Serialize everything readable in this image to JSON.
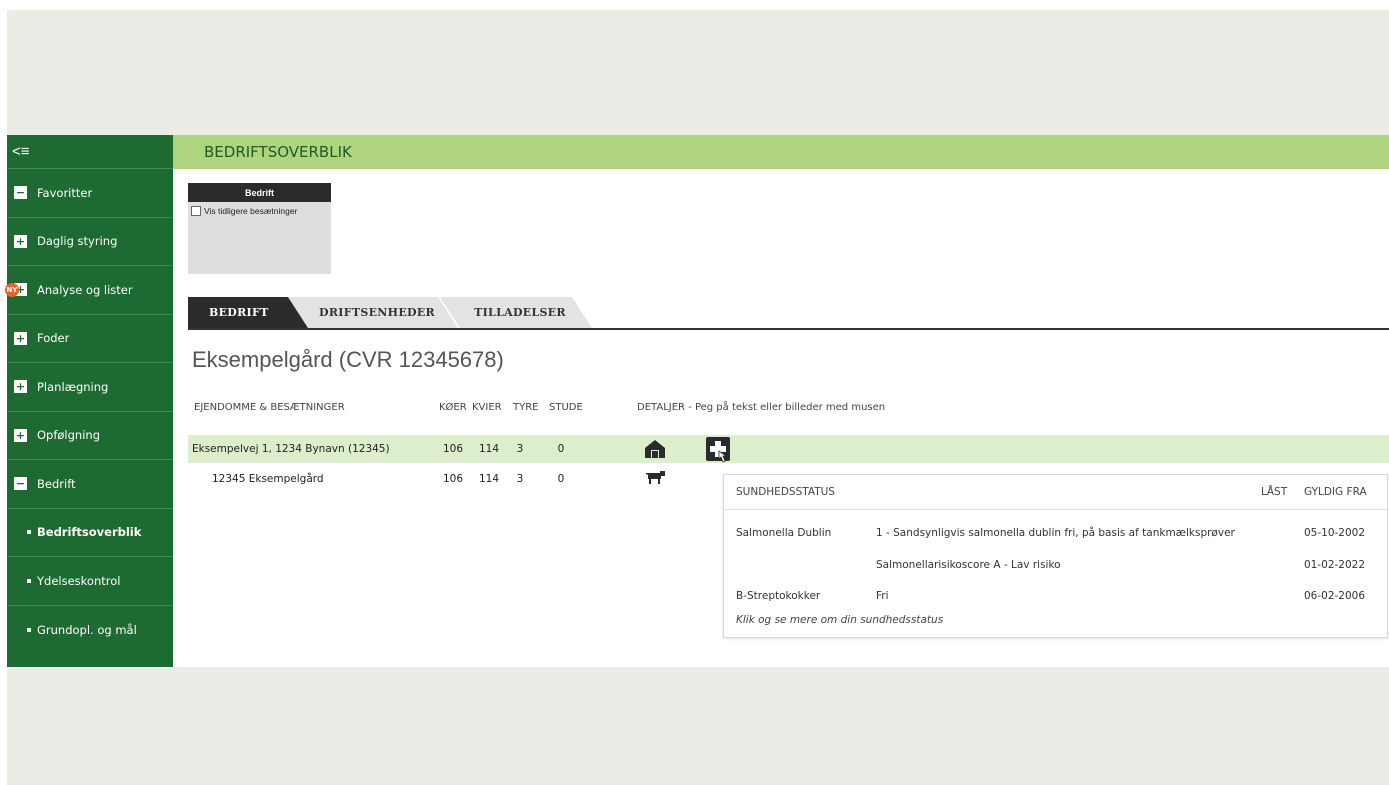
{
  "sidebar": {
    "toggle_label": "<≡",
    "items": [
      {
        "label": "Favoritter",
        "box": "−"
      },
      {
        "label": "Daglig styring",
        "box": "+"
      },
      {
        "label": "Analyse og lister",
        "box": "+",
        "badge": "NY"
      },
      {
        "label": "Foder",
        "box": "+"
      },
      {
        "label": "Planlægning",
        "box": "+"
      },
      {
        "label": "Opfølgning",
        "box": "+"
      },
      {
        "label": "Bedrift",
        "box": "−"
      }
    ],
    "subitems": [
      {
        "label": "Bedriftsoverblik",
        "active": true
      },
      {
        "label": "Ydelseskontrol"
      },
      {
        "label": "Grundopl. og mål"
      }
    ]
  },
  "header": {
    "title": "BEDRIFTSOVERBLIK"
  },
  "filter": {
    "title": "Bedrift",
    "checkbox_label": "Vis tidligere besætninger",
    "checked": false
  },
  "tabs": [
    {
      "label": "BEDRIFT",
      "active": true
    },
    {
      "label": "DRIFTSENHEDER"
    },
    {
      "label": "TILLADELSER"
    }
  ],
  "farm_title": "Eksempelgård (CVR 12345678)",
  "table": {
    "headers": {
      "property": "EJENDOMME & BESÆTNINGER",
      "koer": "KØER",
      "kvier": "KVIER",
      "tyre": "TYRE",
      "stude": "STUDE",
      "details": "DETALJER - Peg på tekst eller billeder med musen"
    },
    "rows": [
      {
        "name": "Eksempelvej 1, 1234 Bynavn (12345)",
        "koer": "106",
        "kvier": "114",
        "tyre": "3",
        "stude": "0",
        "icons": [
          "barn-icon",
          "health-cross-icon"
        ]
      },
      {
        "name": "12345 Eksempelgård",
        "koer": "106",
        "kvier": "114",
        "tyre": "3",
        "stude": "0",
        "icons": [
          "cow-icon"
        ]
      }
    ]
  },
  "health_popup": {
    "header": "SUNDHEDSSTATUS",
    "col_locked": "LÅST",
    "col_valid_from": "GYLDIG FRA",
    "rows": [
      {
        "disease": "Salmonella Dublin",
        "status": "1 - Sandsynligvis salmonella dublin fri, på basis af tankmælksprøver",
        "date": "05-10-2002"
      },
      {
        "disease": "",
        "status": "Salmonellarisikoscore A - Lav risiko",
        "date": "01-02-2022"
      },
      {
        "disease": "B-Streptokokker",
        "status": "Fri",
        "date": "06-02-2006"
      }
    ],
    "more_link": "Klik og se mere om din sundhedsstatus"
  },
  "colors": {
    "sidebar": "#1d6a33",
    "header": "#afd47e",
    "highlight_row": "#dceecb",
    "badge": "#e8622b"
  }
}
